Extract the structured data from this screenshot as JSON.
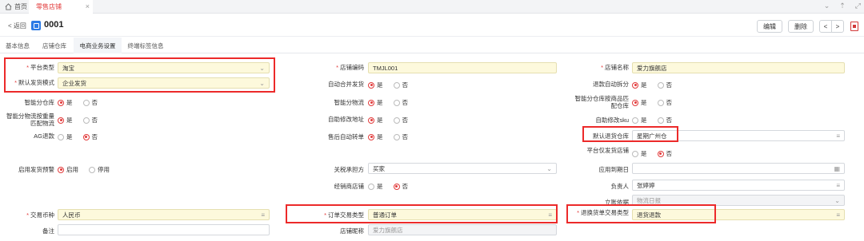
{
  "tabs_top": {
    "home": "首页",
    "active": "零售店铺",
    "close": "×"
  },
  "header": {
    "back": "< 返回",
    "code": "0001",
    "edit": "编辑",
    "delete": "删除",
    "prev": "<",
    "next": ">"
  },
  "sections": [
    "基本信息",
    "店铺仓库",
    "电商业务设置",
    "终端标签信息"
  ],
  "radio_yes": "是",
  "radio_no": "否",
  "fields": {
    "platform_type": {
      "label": "平台类型",
      "value": "淘宝"
    },
    "default_ship_mode": {
      "label": "默认发货模式",
      "value": "企业发货"
    },
    "smart_split_warehouse": {
      "label": "智能分仓库"
    },
    "smart_split_combo": {
      "label": "智能分物流按重量匹配物流"
    },
    "ag_refund": {
      "label": "AG退款"
    },
    "ship_warning": {
      "label": "启用发货预警",
      "on": "启用",
      "off": "停用"
    },
    "currency": {
      "label": "交易币种",
      "value": "人民币"
    },
    "remark": {
      "label": "备注",
      "value": ""
    },
    "shop_code": {
      "label": "店铺编码",
      "value": "TMJL001"
    },
    "auto_merge": {
      "label": "自动合并发货"
    },
    "smart_logistics": {
      "label": "智能分物流"
    },
    "auto_modify_addr": {
      "label": "自助修改地址"
    },
    "aftersale_auto": {
      "label": "售后自动转单"
    },
    "related_party": {
      "label": "关税承担方",
      "value": "买家"
    },
    "distributor_shop": {
      "label": "经销商店铺"
    },
    "order_trade_type": {
      "label": "订单交易类型",
      "value": "普通订单"
    },
    "shop_nick": {
      "label": "店铺昵称",
      "value": "爱力旗舰店"
    },
    "shop_name": {
      "label": "店铺名称",
      "value": "爱力旗舰店"
    },
    "refund_auto_split": {
      "label": "退款自动拆分"
    },
    "smart_split_product": {
      "label": "智能分仓库按商品匹配仓库"
    },
    "auto_modify_sku": {
      "label": "自助修改sku"
    },
    "default_return_wh": {
      "label": "默认退货仓库",
      "value": "星期广州仓"
    },
    "platform_ship_only": {
      "label": "平台仅发货店铺"
    },
    "apply_date": {
      "label": "应用到期日",
      "value": ""
    },
    "owner": {
      "label": "负责人",
      "value": "张婷婷"
    },
    "account_source": {
      "label": "立账依据",
      "value": "物流日报"
    },
    "exchange_trade_type": {
      "label": "退换货单交易类型",
      "value": "退货退款"
    }
  }
}
